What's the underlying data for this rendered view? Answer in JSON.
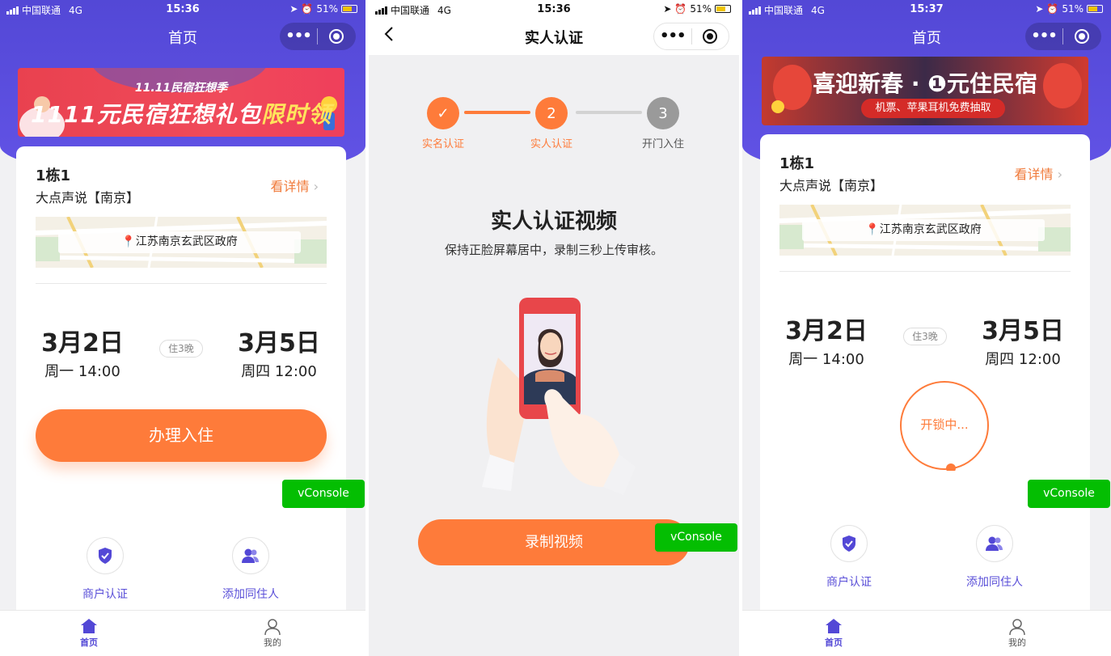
{
  "colors": {
    "brand": "#5348d6",
    "accent": "#fe7b3a",
    "vconsole": "#04be02",
    "step_done": "#fe7b3a",
    "step_pending": "#9a9a9a"
  },
  "screen1": {
    "status": {
      "carrier": "中国联通",
      "network": "4G",
      "time": "15:36",
      "battery": "51%"
    },
    "nav": {
      "title": "首页"
    },
    "banner": {
      "subtitle": "11.11民宿狂想季",
      "main": "1111元民宿狂想礼包",
      "highlight": "限时领"
    },
    "booking": {
      "room": "1栋1",
      "hotel": "大点声说【南京】",
      "details_link": "看详情",
      "address": "江苏南京玄武区政府",
      "checkin_date": "3月2日",
      "checkin_time": "周一 14:00",
      "nights": "住3晚",
      "checkout_date": "3月5日",
      "checkout_time": "周四 12:00"
    },
    "checkin_button": "办理入住",
    "actions": [
      {
        "label": "商户认证",
        "icon": "shield-check-icon"
      },
      {
        "label": "添加同住人",
        "icon": "add-person-icon"
      }
    ],
    "vconsole": "vConsole",
    "tabs": [
      {
        "label": "首页",
        "icon": "home-icon",
        "active": true
      },
      {
        "label": "我的",
        "icon": "user-icon",
        "active": false
      }
    ]
  },
  "screen2": {
    "status": {
      "carrier": "中国联通",
      "network": "4G",
      "time": "15:36",
      "battery": "51%"
    },
    "nav": {
      "title": "实人认证"
    },
    "steps": [
      {
        "num": "✓",
        "label": "实名认证",
        "state": "done"
      },
      {
        "num": "2",
        "label": "实人认证",
        "state": "current"
      },
      {
        "num": "3",
        "label": "开门入住",
        "state": "pending"
      }
    ],
    "title": "实人认证视频",
    "subtitle": "保持正脸屏幕居中，录制三秒上传审核。",
    "record_button": "录制视频",
    "vconsole": "vConsole"
  },
  "screen3": {
    "status": {
      "carrier": "中国联通",
      "network": "4G",
      "time": "15:37",
      "battery": "51%"
    },
    "nav": {
      "title": "首页"
    },
    "banner": {
      "main": "喜迎新春 · ❶元住民宿",
      "pill": "机票、苹果耳机免费抽取"
    },
    "booking": {
      "room": "1栋1",
      "hotel": "大点声说【南京】",
      "details_link": "看详情",
      "address": "江苏南京玄武区政府",
      "checkin_date": "3月2日",
      "checkin_time": "周一 14:00",
      "nights": "住3晚",
      "checkout_date": "3月5日",
      "checkout_time": "周四 12:00"
    },
    "unlock_status": "开锁中...",
    "actions": [
      {
        "label": "商户认证",
        "icon": "shield-check-icon"
      },
      {
        "label": "添加同住人",
        "icon": "add-person-icon"
      }
    ],
    "vconsole": "vConsole",
    "tabs": [
      {
        "label": "首页",
        "icon": "home-icon",
        "active": true
      },
      {
        "label": "我的",
        "icon": "user-icon",
        "active": false
      }
    ]
  }
}
